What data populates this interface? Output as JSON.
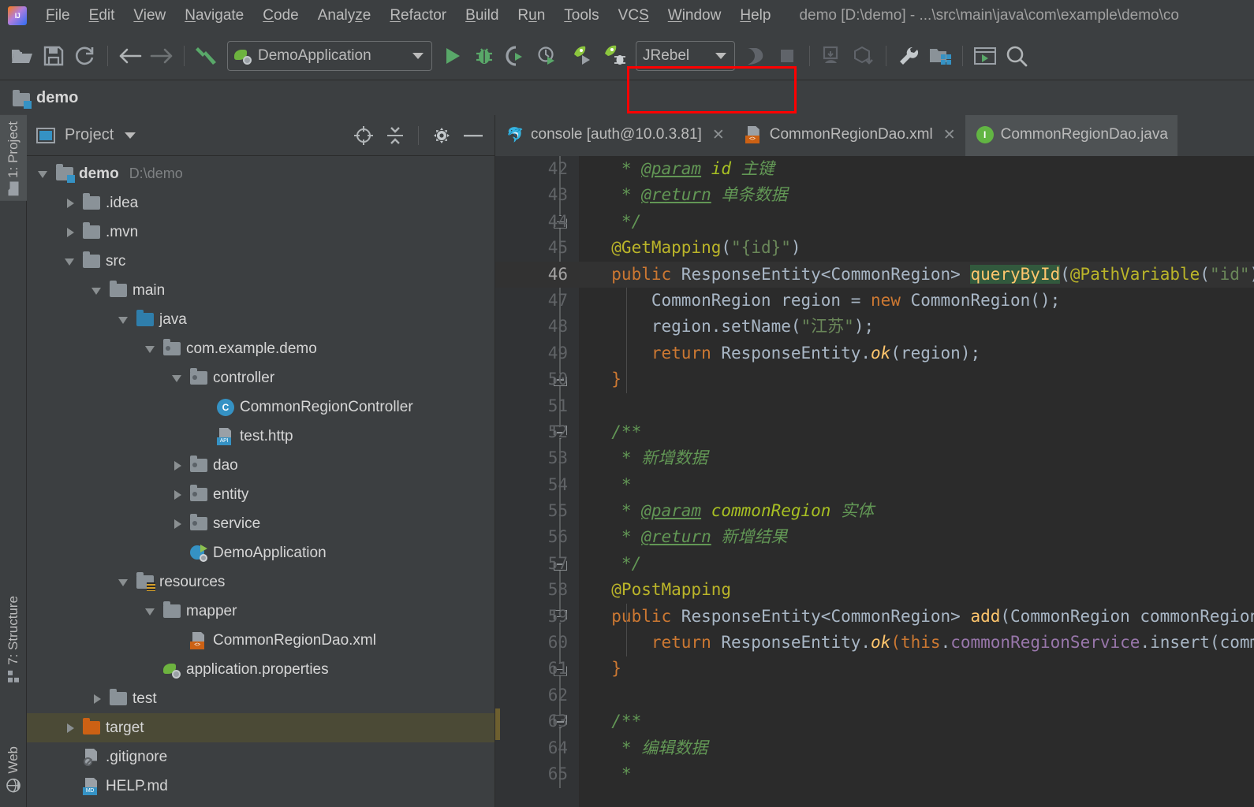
{
  "window": {
    "title": "demo [D:\\demo] - ...\\src\\main\\java\\com\\example\\demo\\co",
    "logo": "intellij-idea-logo"
  },
  "menubar": {
    "items": [
      {
        "label": "File",
        "mnemonic": 0
      },
      {
        "label": "Edit",
        "mnemonic": 0
      },
      {
        "label": "View",
        "mnemonic": 0
      },
      {
        "label": "Navigate",
        "mnemonic": 0
      },
      {
        "label": "Code",
        "mnemonic": 0
      },
      {
        "label": "Analyze",
        "mnemonic": 5
      },
      {
        "label": "Refactor",
        "mnemonic": 0
      },
      {
        "label": "Build",
        "mnemonic": 0
      },
      {
        "label": "Run",
        "mnemonic": 1
      },
      {
        "label": "Tools",
        "mnemonic": 0
      },
      {
        "label": "VCS",
        "mnemonic": 2
      },
      {
        "label": "Window",
        "mnemonic": 0
      },
      {
        "label": "Help",
        "mnemonic": 0
      }
    ]
  },
  "toolbar": {
    "buttons": [
      {
        "name": "open-project-icon",
        "tooltip": "Open"
      },
      {
        "name": "save-all-icon",
        "tooltip": "Save All"
      },
      {
        "name": "sync-refresh-icon",
        "tooltip": "Synchronize"
      },
      {
        "name": "back-arrow-icon",
        "tooltip": "Back"
      },
      {
        "name": "forward-arrow-icon",
        "tooltip": "Forward"
      },
      {
        "name": "build-hammer-icon",
        "tooltip": "Build Project"
      }
    ],
    "run_config": {
      "label": "DemoApplication",
      "icon": "spring-boot-icon"
    },
    "run_buttons": [
      {
        "name": "run-icon",
        "tooltip": "Run"
      },
      {
        "name": "debug-icon",
        "tooltip": "Debug"
      },
      {
        "name": "run-with-coverage-icon",
        "tooltip": "Run with Coverage"
      },
      {
        "name": "profiler-icon",
        "tooltip": "Profiler"
      },
      {
        "name": "jrebel-run-icon",
        "tooltip": "Run with JRebel"
      },
      {
        "name": "jrebel-debug-icon",
        "tooltip": "Debug with JRebel"
      }
    ],
    "jrebel_combo": {
      "label": "JRebel"
    },
    "right_buttons": [
      {
        "name": "attach-profiler-icon",
        "tooltip": "Attach Profiler"
      },
      {
        "name": "stop-icon",
        "tooltip": "Stop"
      },
      {
        "name": "update-project-icon",
        "tooltip": "Update Project"
      },
      {
        "name": "commit-icon",
        "tooltip": "Commit"
      },
      {
        "name": "settings-wrench-icon",
        "tooltip": "Settings"
      },
      {
        "name": "project-structure-icon",
        "tooltip": "Project Structure"
      },
      {
        "name": "terminal-run-anything-icon",
        "tooltip": "Run Anything"
      },
      {
        "name": "search-everywhere-icon",
        "tooltip": "Search Everywhere"
      }
    ],
    "highlight_color": "#ff0000"
  },
  "navbar": {
    "crumb": "demo"
  },
  "left_toolstrip": [
    {
      "label": "1: Project",
      "icon": "folder-icon",
      "active": true
    },
    {
      "label": "7: Structure",
      "icon": "structure-icon",
      "active": false
    },
    {
      "label": "Web",
      "icon": "globe-icon",
      "active": false
    }
  ],
  "project_panel": {
    "title": "Project",
    "actions": [
      {
        "name": "select-opened-file-icon"
      },
      {
        "name": "collapse-all-icon"
      },
      {
        "name": "settings-gear-icon"
      },
      {
        "name": "hide-panel-icon"
      }
    ],
    "tree": [
      {
        "depth": 0,
        "twisty": "open",
        "icon": "module-folder",
        "label": "demo",
        "path": "D:\\demo",
        "bold": true,
        "selected": false
      },
      {
        "depth": 1,
        "twisty": "closed",
        "icon": "folder",
        "label": ".idea",
        "path": "",
        "bold": false,
        "selected": false
      },
      {
        "depth": 1,
        "twisty": "closed",
        "icon": "folder",
        "label": ".mvn",
        "path": "",
        "bold": false,
        "selected": false
      },
      {
        "depth": 1,
        "twisty": "open",
        "icon": "folder",
        "label": "src",
        "path": "",
        "bold": false,
        "selected": false
      },
      {
        "depth": 2,
        "twisty": "open",
        "icon": "folder",
        "label": "main",
        "path": "",
        "bold": false,
        "selected": false
      },
      {
        "depth": 3,
        "twisty": "open",
        "icon": "folder-blue",
        "label": "java",
        "path": "",
        "bold": false,
        "selected": false
      },
      {
        "depth": 4,
        "twisty": "open",
        "icon": "package",
        "label": "com.example.demo",
        "path": "",
        "bold": false,
        "selected": false
      },
      {
        "depth": 5,
        "twisty": "open",
        "icon": "package",
        "label": "controller",
        "path": "",
        "bold": false,
        "selected": false
      },
      {
        "depth": 6,
        "twisty": "none",
        "icon": "class",
        "label": "CommonRegionController",
        "path": "",
        "bold": false,
        "selected": false
      },
      {
        "depth": 6,
        "twisty": "none",
        "icon": "http-file",
        "label": "test.http",
        "path": "",
        "bold": false,
        "selected": false
      },
      {
        "depth": 5,
        "twisty": "closed",
        "icon": "package",
        "label": "dao",
        "path": "",
        "bold": false,
        "selected": false
      },
      {
        "depth": 5,
        "twisty": "closed",
        "icon": "package",
        "label": "entity",
        "path": "",
        "bold": false,
        "selected": false
      },
      {
        "depth": 5,
        "twisty": "closed",
        "icon": "package",
        "label": "service",
        "path": "",
        "bold": false,
        "selected": false
      },
      {
        "depth": 5,
        "twisty": "none",
        "icon": "spring-boot",
        "label": "DemoApplication",
        "path": "",
        "bold": false,
        "selected": false
      },
      {
        "depth": 3,
        "twisty": "open",
        "icon": "resources-folder",
        "label": "resources",
        "path": "",
        "bold": false,
        "selected": false
      },
      {
        "depth": 4,
        "twisty": "open",
        "icon": "folder",
        "label": "mapper",
        "path": "",
        "bold": false,
        "selected": false
      },
      {
        "depth": 5,
        "twisty": "none",
        "icon": "xml-file",
        "label": "CommonRegionDao.xml",
        "path": "",
        "bold": false,
        "selected": false
      },
      {
        "depth": 4,
        "twisty": "none",
        "icon": "spring-props",
        "label": "application.properties",
        "path": "",
        "bold": false,
        "selected": false
      },
      {
        "depth": 2,
        "twisty": "closed",
        "icon": "folder",
        "label": "test",
        "path": "",
        "bold": false,
        "selected": false
      },
      {
        "depth": 1,
        "twisty": "closed",
        "icon": "folder-orange",
        "label": "target",
        "path": "",
        "bold": false,
        "selected": true
      },
      {
        "depth": 1,
        "twisty": "none",
        "icon": "gitignore-file",
        "label": ".gitignore",
        "path": "",
        "bold": false,
        "selected": false
      },
      {
        "depth": 1,
        "twisty": "none",
        "icon": "md-file",
        "label": "HELP.md",
        "path": "",
        "bold": false,
        "selected": false
      }
    ]
  },
  "editor": {
    "tabs": [
      {
        "label": "console [auth@10.0.3.81]",
        "icon": "mysql-dolphin-icon",
        "closable": true,
        "active": false
      },
      {
        "label": "CommonRegionDao.xml",
        "icon": "xml-file-icon",
        "closable": true,
        "active": false
      },
      {
        "label": "CommonRegionDao.java",
        "icon": "interface-icon",
        "closable": false,
        "active": true
      }
    ],
    "first_line": 42,
    "current_line": 46,
    "lines": [
      {
        "n": 42,
        "fold": "",
        "tokens": [
          {
            "t": "   * ",
            "c": "c-comment"
          },
          {
            "t": "@param",
            "c": "c-tag"
          },
          {
            "t": " ",
            "c": "c-comment"
          },
          {
            "t": "id",
            "c": "c-param"
          },
          {
            "t": " 主键",
            "c": "c-comment"
          }
        ]
      },
      {
        "n": 43,
        "fold": "",
        "tokens": [
          {
            "t": "   * ",
            "c": "c-comment"
          },
          {
            "t": "@return",
            "c": "c-tag"
          },
          {
            "t": " 单条数据",
            "c": "c-comment"
          }
        ]
      },
      {
        "n": 44,
        "fold": "bot",
        "tokens": [
          {
            "t": "   */",
            "c": "c-comment"
          }
        ]
      },
      {
        "n": 45,
        "fold": "",
        "tokens": [
          {
            "t": "  @GetMapping",
            "c": "c-anno"
          },
          {
            "t": "(",
            "c": "c-ident"
          },
          {
            "t": "\"{id}\"",
            "c": "c-str"
          },
          {
            "t": ")",
            "c": "c-ident"
          }
        ]
      },
      {
        "n": 46,
        "fold": "topcur",
        "tokens": [
          {
            "t": "  public ",
            "c": "c-kw"
          },
          {
            "t": "ResponseEntity<CommonRegion> ",
            "c": "c-type"
          },
          {
            "t": "queryById",
            "c": "c-method hl-usage"
          },
          {
            "t": "(",
            "c": "c-ident"
          },
          {
            "t": "@PathVariable",
            "c": "c-anno"
          },
          {
            "t": "(",
            "c": "c-ident"
          },
          {
            "t": "\"id\"",
            "c": "c-str"
          },
          {
            "t": ")",
            "c": "c-ident"
          }
        ]
      },
      {
        "n": 47,
        "fold": "",
        "tokens": [
          {
            "t": "      CommonRegion region = ",
            "c": "c-type"
          },
          {
            "t": "new ",
            "c": "c-kw"
          },
          {
            "t": "CommonRegion();",
            "c": "c-type"
          }
        ]
      },
      {
        "n": 48,
        "fold": "",
        "tokens": [
          {
            "t": "      region.setName(",
            "c": "c-type"
          },
          {
            "t": "\"江苏\"",
            "c": "c-str"
          },
          {
            "t": ");",
            "c": "c-type"
          }
        ]
      },
      {
        "n": 49,
        "fold": "",
        "tokens": [
          {
            "t": "      return ",
            "c": "c-kw"
          },
          {
            "t": "ResponseEntity.",
            "c": "c-type"
          },
          {
            "t": "ok",
            "c": "c-static"
          },
          {
            "t": "(region);",
            "c": "c-type"
          }
        ]
      },
      {
        "n": 50,
        "fold": "bot",
        "tokens": [
          {
            "t": "  }",
            "c": "c-kw"
          }
        ]
      },
      {
        "n": 51,
        "fold": "",
        "tokens": []
      },
      {
        "n": 52,
        "fold": "top",
        "tokens": [
          {
            "t": "  /**",
            "c": "c-comment"
          }
        ]
      },
      {
        "n": 53,
        "fold": "",
        "tokens": [
          {
            "t": "   * 新增数据",
            "c": "c-comment"
          }
        ]
      },
      {
        "n": 54,
        "fold": "",
        "tokens": [
          {
            "t": "   *",
            "c": "c-comment"
          }
        ]
      },
      {
        "n": 55,
        "fold": "",
        "tokens": [
          {
            "t": "   * ",
            "c": "c-comment"
          },
          {
            "t": "@param",
            "c": "c-tag"
          },
          {
            "t": " ",
            "c": "c-comment"
          },
          {
            "t": "commonRegion",
            "c": "c-param"
          },
          {
            "t": " 实体",
            "c": "c-comment"
          }
        ]
      },
      {
        "n": 56,
        "fold": "",
        "tokens": [
          {
            "t": "   * ",
            "c": "c-comment"
          },
          {
            "t": "@return",
            "c": "c-tag"
          },
          {
            "t": " 新增结果",
            "c": "c-comment"
          }
        ]
      },
      {
        "n": 57,
        "fold": "bot",
        "tokens": [
          {
            "t": "   */",
            "c": "c-comment"
          }
        ]
      },
      {
        "n": 58,
        "fold": "",
        "tokens": [
          {
            "t": "  @PostMapping",
            "c": "c-anno"
          }
        ]
      },
      {
        "n": 59,
        "fold": "top",
        "tokens": [
          {
            "t": "  public ",
            "c": "c-kw"
          },
          {
            "t": "ResponseEntity<CommonRegion> ",
            "c": "c-type"
          },
          {
            "t": "add",
            "c": "c-method"
          },
          {
            "t": "(CommonRegion commonRegion)",
            "c": "c-type"
          }
        ]
      },
      {
        "n": 60,
        "fold": "",
        "tokens": [
          {
            "t": "      return ",
            "c": "c-kw"
          },
          {
            "t": "ResponseEntity.",
            "c": "c-type"
          },
          {
            "t": "ok",
            "c": "c-static"
          },
          {
            "t": "(",
            "c": "c-kw"
          },
          {
            "t": "this",
            "c": "c-kw"
          },
          {
            "t": ".",
            "c": "c-type"
          },
          {
            "t": "commonRegionService",
            "c": "c-field"
          },
          {
            "t": ".insert(commo",
            "c": "c-type"
          }
        ]
      },
      {
        "n": 61,
        "fold": "bot",
        "tokens": [
          {
            "t": "  }",
            "c": "c-kw"
          }
        ]
      },
      {
        "n": 62,
        "fold": "",
        "tokens": []
      },
      {
        "n": 63,
        "fold": "top",
        "tokens": [
          {
            "t": "  /**",
            "c": "c-comment"
          }
        ]
      },
      {
        "n": 64,
        "fold": "",
        "tokens": [
          {
            "t": "   * 编辑数据",
            "c": "c-comment"
          }
        ]
      },
      {
        "n": 65,
        "fold": "",
        "tokens": [
          {
            "t": "   *",
            "c": "c-comment"
          }
        ]
      }
    ]
  },
  "colors": {
    "panel_bg": "#3c3f41",
    "editor_bg": "#2b2b2b",
    "gutter_bg": "#313335",
    "selection_bg": "#4b4a36",
    "accent_blue": "#3592c4",
    "accent_green": "#6db33f",
    "accent_orange": "#cc6114",
    "highlight_red": "#ff0000"
  }
}
